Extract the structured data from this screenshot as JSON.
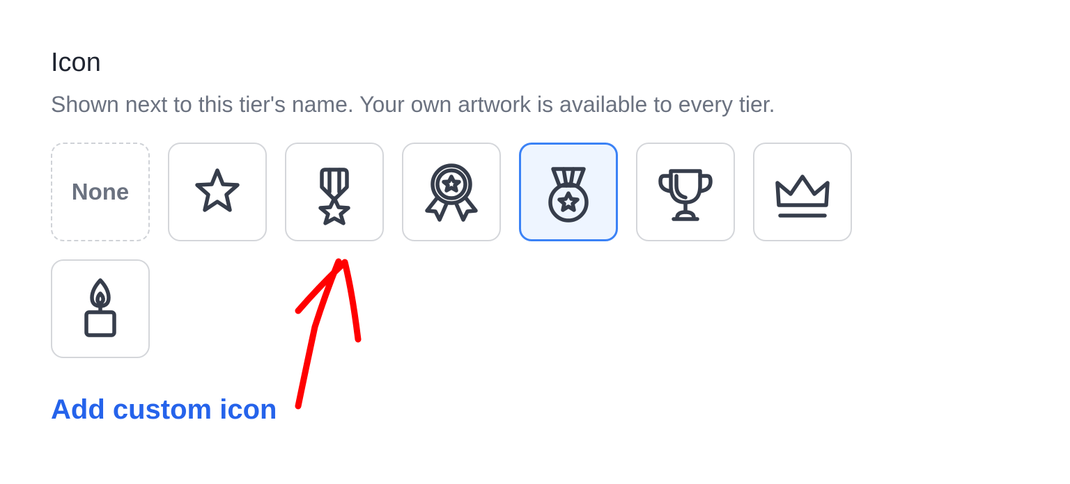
{
  "field": {
    "label": "Icon",
    "description": "Shown next to this tier's name. Your own artwork is available to every tier."
  },
  "icons": {
    "none_label": "None",
    "options": [
      {
        "name": "none",
        "selected": false
      },
      {
        "name": "star-icon",
        "selected": false
      },
      {
        "name": "ribbon-star-medal-icon",
        "selected": false
      },
      {
        "name": "award-rosette-icon",
        "selected": false
      },
      {
        "name": "medal-icon",
        "selected": true
      },
      {
        "name": "trophy-icon",
        "selected": false
      },
      {
        "name": "crown-icon",
        "selected": false
      },
      {
        "name": "candle-icon",
        "selected": false
      }
    ]
  },
  "actions": {
    "add_custom_icon": "Add custom icon"
  },
  "colors": {
    "accent": "#2563eb",
    "selected_border": "#3b82f6",
    "selected_bg": "#eef5ff",
    "annotation_arrow": "#ff0000"
  }
}
